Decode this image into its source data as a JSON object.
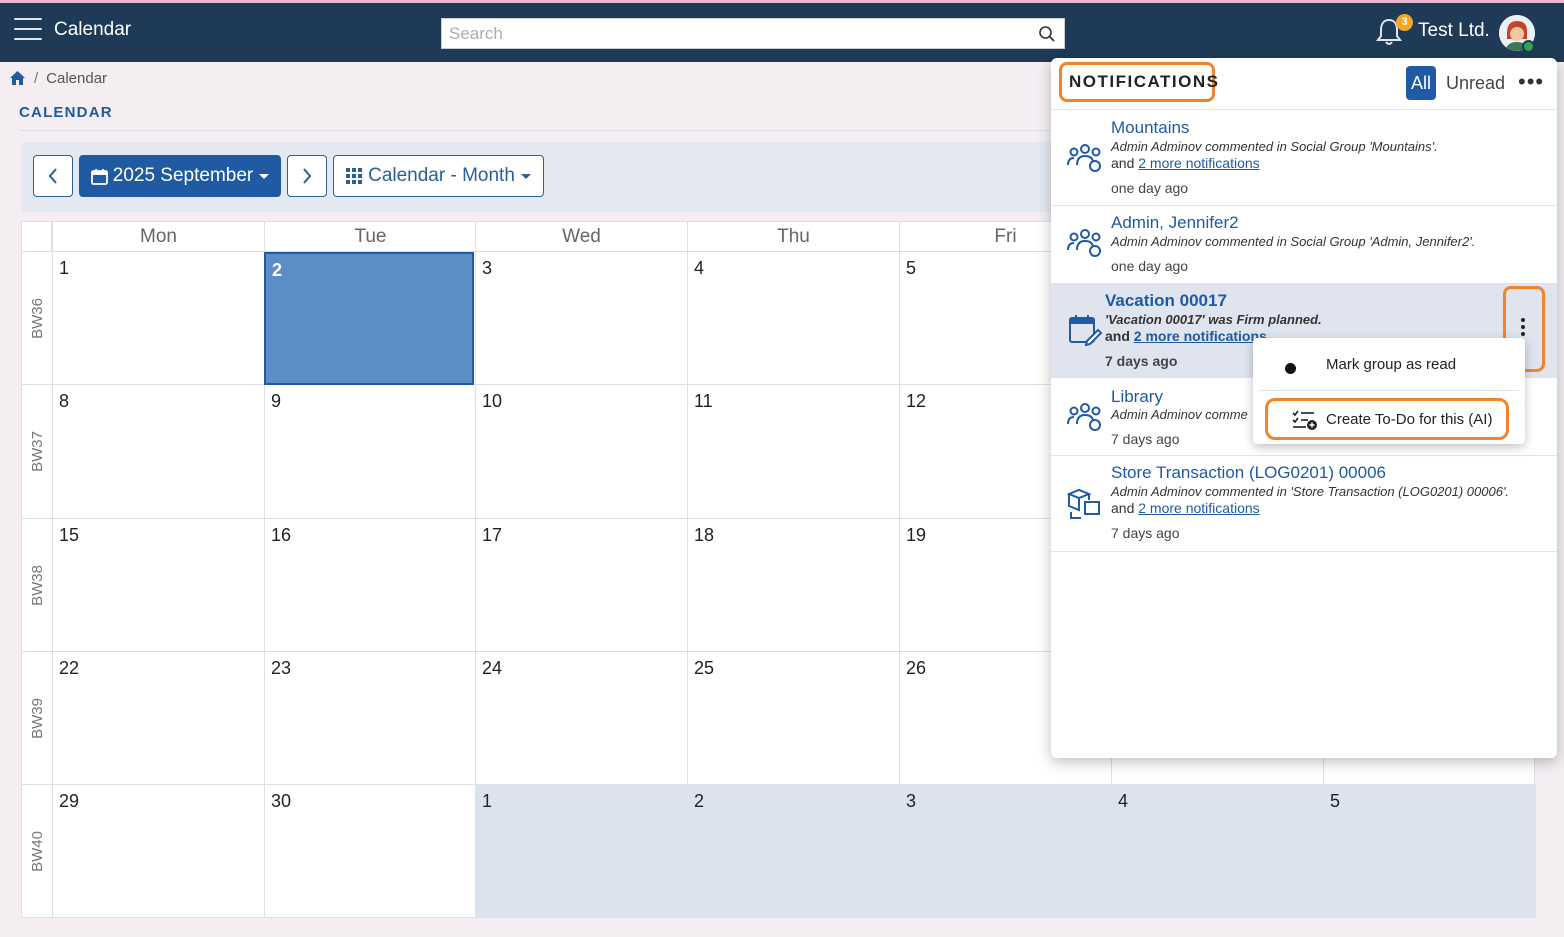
{
  "header": {
    "app_title": "Calendar",
    "search_placeholder": "Search",
    "notification_count": "3",
    "company_name": "Test Ltd."
  },
  "breadcrumb": {
    "current": "Calendar",
    "separator": "/"
  },
  "page_title": "CALENDAR",
  "toolbar": {
    "month_label": "2025 September",
    "view_label": "Calendar - Month"
  },
  "calendar": {
    "days_of_week": [
      "Mon",
      "Tue",
      "Wed",
      "Thu",
      "Fri"
    ],
    "weeks": [
      {
        "label": "BW36",
        "days": [
          "1",
          "2",
          "3",
          "4",
          "5"
        ]
      },
      {
        "label": "BW37",
        "days": [
          "8",
          "9",
          "10",
          "11",
          "12"
        ]
      },
      {
        "label": "BW38",
        "days": [
          "15",
          "16",
          "17",
          "18",
          "19"
        ]
      },
      {
        "label": "BW39",
        "days": [
          "22",
          "23",
          "24",
          "25",
          "26"
        ]
      },
      {
        "label": "BW40",
        "days": [
          "29",
          "30",
          "1",
          "2",
          "3",
          "4",
          "5"
        ]
      }
    ],
    "selected_day": "2"
  },
  "notifications": {
    "title": "NOTIFICATIONS",
    "filter_all": "All",
    "filter_unread": "Unread",
    "items": [
      {
        "title": "Mountains",
        "description": "Admin Adminov commented in Social Group 'Mountains'.",
        "more_prefix": "and",
        "more_link": "2 more notifications",
        "time": "one day  ago",
        "icon": "group-icon"
      },
      {
        "title": "Admin, Jennifer2",
        "description": "Admin Adminov commented in Social Group 'Admin, Jennifer2'.",
        "time": "one day  ago",
        "icon": "group-icon"
      },
      {
        "title": "Vacation 00017",
        "description": "'Vacation 00017' was Firm planned.",
        "more_prefix": "and",
        "more_link": "2 more notifications",
        "time": "7 days ago",
        "icon": "calendar-edit-icon"
      },
      {
        "title": "Library",
        "description": "Admin Adminov comme",
        "time": "7 days ago",
        "icon": "group-icon"
      },
      {
        "title": "Store Transaction (LOG0201) 00006",
        "description": "Admin Adminov commented in 'Store Transaction (LOG0201) 00006'.",
        "more_prefix": "and",
        "more_link": "2 more notifications",
        "time": "7 days ago",
        "icon": "store-transaction-icon"
      }
    ],
    "context_menu": {
      "mark_read": "Mark group as read",
      "create_todo": "Create To-Do for this (AI)"
    }
  },
  "colors": {
    "header_bg": "#1f3a56",
    "primary": "#1f5aa3",
    "highlight_ring": "#f0842c",
    "badge": "#f5a623"
  }
}
